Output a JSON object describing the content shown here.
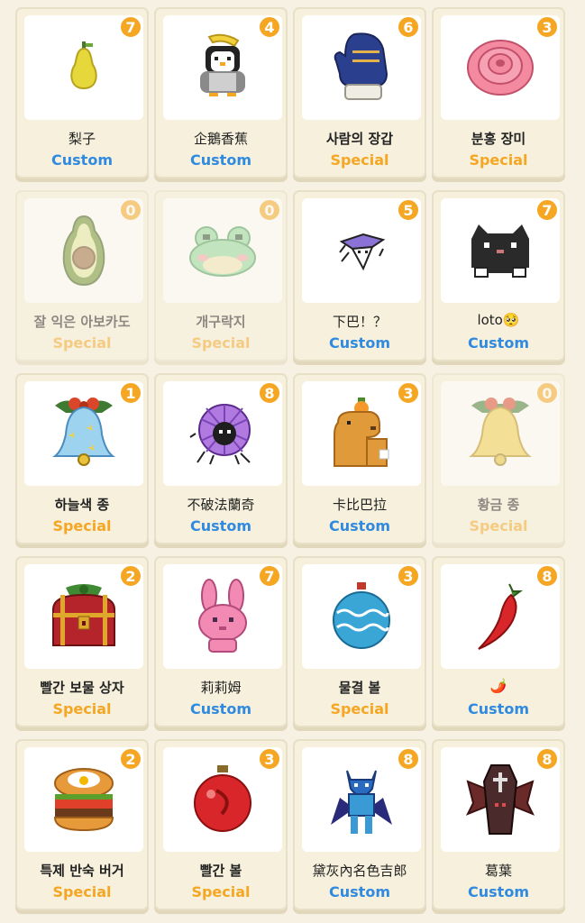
{
  "colors": {
    "badge": "#f5a623",
    "custom_label": "#2f8ae0",
    "special_label": "#f5a623",
    "card_bg": "#f6f0dc",
    "page_bg": "#f6f1e3"
  },
  "items": [
    {
      "name": "梨子",
      "type": "Custom",
      "count": "7",
      "icon": "pear-icon",
      "owned": true
    },
    {
      "name": "企鵝香蕉",
      "type": "Custom",
      "count": "4",
      "icon": "penguin-banana-icon",
      "owned": true
    },
    {
      "name": "사람의 장갑",
      "type": "Special",
      "count": "6",
      "icon": "mitten-icon",
      "owned": true
    },
    {
      "name": "분홍 장미",
      "type": "Special",
      "count": "3",
      "icon": "pink-rose-icon",
      "owned": true
    },
    {
      "name": "잘 익은 아보카도",
      "type": "Special",
      "count": "0",
      "icon": "avocado-icon",
      "owned": false
    },
    {
      "name": "개구락지",
      "type": "Special",
      "count": "0",
      "icon": "frog-icon",
      "owned": false
    },
    {
      "name": "下巴！？",
      "type": "Custom",
      "count": "5",
      "icon": "chin-doodle-icon",
      "owned": true
    },
    {
      "name": "loto🥺",
      "type": "Custom",
      "count": "7",
      "icon": "black-cat-icon",
      "owned": true
    },
    {
      "name": "하늘색 종",
      "type": "Special",
      "count": "1",
      "icon": "sky-blue-bell-icon",
      "owned": true
    },
    {
      "name": "不破法蘭奇",
      "type": "Custom",
      "count": "8",
      "icon": "purple-fluff-icon",
      "owned": true
    },
    {
      "name": "卡比巴拉",
      "type": "Custom",
      "count": "3",
      "icon": "capybara-icon",
      "owned": true
    },
    {
      "name": "황금 종",
      "type": "Special",
      "count": "0",
      "icon": "golden-bell-icon",
      "owned": false
    },
    {
      "name": "빨간 보물 상자",
      "type": "Special",
      "count": "2",
      "icon": "red-treasure-chest-icon",
      "owned": true
    },
    {
      "name": "莉莉姆",
      "type": "Custom",
      "count": "7",
      "icon": "pink-bunny-icon",
      "owned": true
    },
    {
      "name": "물결 볼",
      "type": "Special",
      "count": "3",
      "icon": "wave-ornament-icon",
      "owned": true
    },
    {
      "name": "🌶️",
      "type": "Custom",
      "count": "8",
      "icon": "chili-pepper-icon",
      "owned": true
    },
    {
      "name": "특제 반숙 버거",
      "type": "Special",
      "count": "2",
      "icon": "burger-icon",
      "owned": true
    },
    {
      "name": "빨간 볼",
      "type": "Special",
      "count": "3",
      "icon": "red-ornament-icon",
      "owned": true
    },
    {
      "name": "黛灰內名色吉郎",
      "type": "Custom",
      "count": "8",
      "icon": "blue-demon-icon",
      "owned": true
    },
    {
      "name": "葛葉",
      "type": "Custom",
      "count": "8",
      "icon": "coffin-bat-icon",
      "owned": true
    }
  ]
}
